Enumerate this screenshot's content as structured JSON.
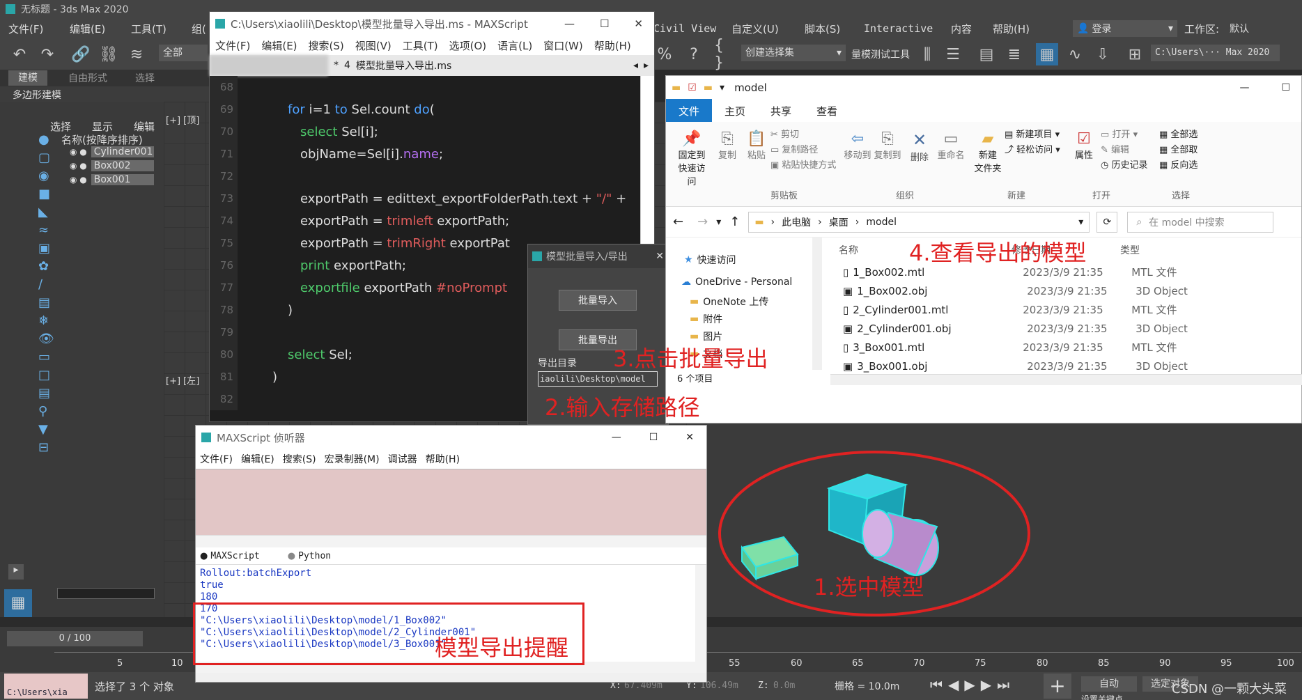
{
  "max": {
    "title": "无标题 - 3ds Max 2020",
    "menu_left": [
      "文件(F)",
      "编辑(E)",
      "工具(T)",
      "组("
    ],
    "menu_right": [
      "Civil View",
      "自定义(U)",
      "脚本(S)",
      "Interactive",
      "内容",
      "帮助(H)"
    ],
    "login": "登录",
    "workspace_label": "工作区:",
    "workspace_value": "默认",
    "toolbar_all": "全部",
    "selection_set": "创建选择集",
    "path_display": "C:\\Users\\··· Max 2020",
    "batch_toolbar": "量模测试工具",
    "ribbon_tabs": [
      "建模",
      "自由形式",
      "选择"
    ],
    "ribbon_sub": "多边形建模",
    "panel_tabs": [
      "选择",
      "显示",
      "编辑"
    ],
    "scene_header": "名称(按降序排序)",
    "scene_items": [
      "Cylinder001",
      "Box002",
      "Box001"
    ],
    "viewport_top": "[+] [顶]",
    "viewport_left": "[+] [左]",
    "time_display": "0 / 100",
    "timeline_ticks": [
      "5",
      "10",
      "55",
      "60",
      "65",
      "70",
      "75",
      "80",
      "85",
      "90",
      "95",
      "100"
    ],
    "status_selected": "选择了 3 个 对象",
    "status_path": "C:\\Users\\xia",
    "coord_x_label": "X:",
    "coord_x": "67.409m",
    "coord_y_label": "Y:",
    "coord_y": "106.49m",
    "coord_z_label": "Z:",
    "coord_z": "0.0m",
    "grid_label": "栅格 = 10.0m",
    "auto_key": "自动",
    "select_obj": "选定对象",
    "set_key": "设置关键点",
    "watermark": "CSDN @一颗大头菜"
  },
  "editor": {
    "title": "C:\\Users\\xiaolili\\Desktop\\模型批量导入导出.ms - MAXScript",
    "menu": [
      "文件(F)",
      "编辑(E)",
      "搜索(S)",
      "视图(V)",
      "工具(T)",
      "选项(O)",
      "语言(L)",
      "窗口(W)",
      "帮助(H)"
    ],
    "tab_num": "4",
    "tab_name": "模型批量导入导出.ms",
    "lines": [
      {
        "n": "68",
        "code": ""
      },
      {
        "n": "69",
        "code": "for i=1 to Sel.count do("
      },
      {
        "n": "70",
        "code": "select Sel[i];"
      },
      {
        "n": "71",
        "code": "objName=Sel[i].name;"
      },
      {
        "n": "72",
        "code": ""
      },
      {
        "n": "73",
        "code": "exportPath = edittext_exportFolderPath.text + \"/\" +"
      },
      {
        "n": "74",
        "code": "exportPath = trimleft exportPath;"
      },
      {
        "n": "75",
        "code": "exportPath = trimRight exportPat"
      },
      {
        "n": "76",
        "code": "print exportPath;"
      },
      {
        "n": "77",
        "code": "exportfile exportPath #noPrompt"
      },
      {
        "n": "78",
        "code": ")"
      },
      {
        "n": "79",
        "code": ""
      },
      {
        "n": "80",
        "code": "select Sel;"
      },
      {
        "n": "81",
        "code": ")"
      },
      {
        "n": "82",
        "code": ""
      }
    ]
  },
  "batch": {
    "title": "模型批量导入/导出",
    "import_btn": "批量导入",
    "export_btn": "批量导出",
    "dir_label": "导出目录",
    "dir_value": "iaolili\\Desktop\\model"
  },
  "explorer": {
    "title": "model",
    "tabs": [
      "文件",
      "主页",
      "共享",
      "查看"
    ],
    "pin": "固定到\n快速访问",
    "copy": "复制",
    "paste": "粘贴",
    "cut": "剪切",
    "copy_path": "复制路径",
    "paste_shortcut": "粘贴快捷方式",
    "move_to": "移动到",
    "copy_to": "复制到",
    "delete": "删除",
    "rename": "重命名",
    "new_folder": "新建\n文件夹",
    "new_item": "新建项目",
    "easy_access": "轻松访问",
    "properties": "属性",
    "open": "打开",
    "edit": "编辑",
    "history": "历史记录",
    "select_all": "全部选",
    "select_none": "全部取",
    "invert": "反向选",
    "groups": [
      "剪贴板",
      "组织",
      "新建",
      "打开",
      "选择"
    ],
    "breadcrumb": [
      "此电脑",
      "桌面",
      "model"
    ],
    "search_placeholder": "在 model 中搜索",
    "nav": [
      "快速访问",
      "OneDrive - Personal",
      "OneNote 上传",
      "附件",
      "图片",
      "文档"
    ],
    "col_name": "名称",
    "col_date": "修改日期",
    "col_type": "类型",
    "files": [
      {
        "name": "1_Box002.mtl",
        "date": "2023/3/9 21:35",
        "type": "MTL 文件"
      },
      {
        "name": "1_Box002.obj",
        "date": "2023/3/9 21:35",
        "type": "3D Object"
      },
      {
        "name": "2_Cylinder001.mtl",
        "date": "2023/3/9 21:35",
        "type": "MTL 文件"
      },
      {
        "name": "2_Cylinder001.obj",
        "date": "2023/3/9 21:35",
        "type": "3D Object"
      },
      {
        "name": "3_Box001.mtl",
        "date": "2023/3/9 21:35",
        "type": "MTL 文件"
      },
      {
        "name": "3_Box001.obj",
        "date": "2023/3/9 21:35",
        "type": "3D Object"
      }
    ],
    "item_count": "6 个项目"
  },
  "listener": {
    "title": "MAXScript 侦听器",
    "menu": [
      "文件(F)",
      "编辑(E)",
      "搜索(S)",
      "宏录制器(M)",
      "调试器",
      "帮助(H)"
    ],
    "radio_max": "MAXScript",
    "radio_py": "Python",
    "output": [
      "Rollout:batchExport",
      "true",
      "180",
      "170",
      "\"C:\\Users\\xiaolili\\Desktop\\model/1_Box002\"",
      "\"C:\\Users\\xiaolili\\Desktop\\model/2_Cylinder001\"",
      "\"C:\\Users\\xiaolili\\Desktop\\model/3_Box001\""
    ]
  },
  "annotations": {
    "step1": "1.选中模型",
    "step2": "2.输入存储路径",
    "step3": "3.点击批量导出",
    "step4": "4.查看导出的模型",
    "tip": "模型导出提醒"
  },
  "colors": {
    "annotation": "#e02222",
    "box_cyan": "#1fb6c9",
    "cylinder": "#c9a0dc",
    "box_green": "#7fe0a8"
  }
}
